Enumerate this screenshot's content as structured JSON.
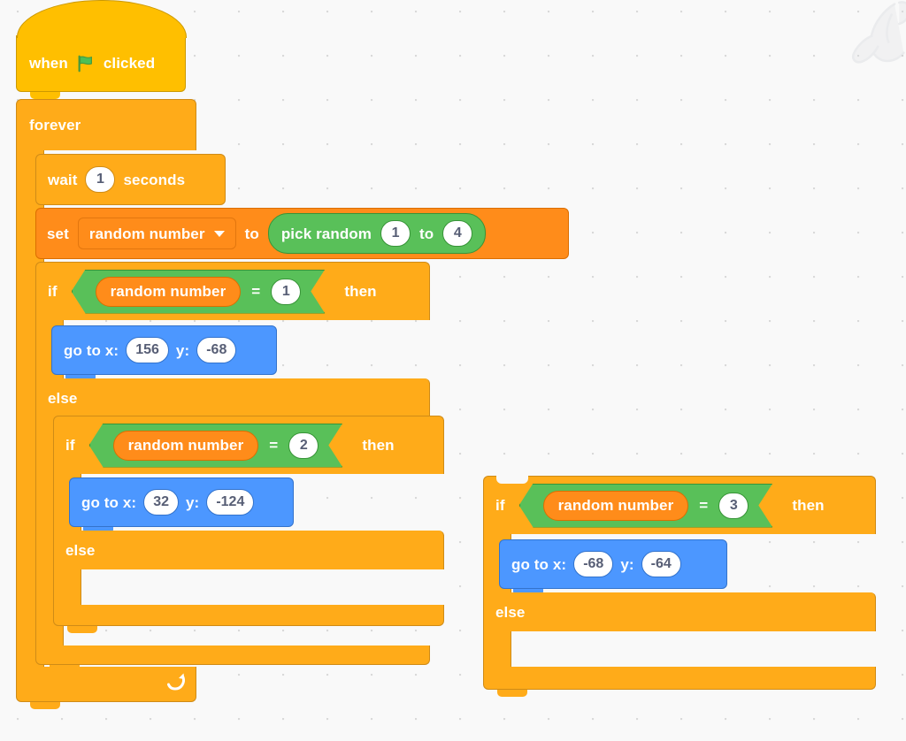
{
  "app": {
    "name": "Scratch",
    "watermark_icon": "scratch-cat-watermark-icon",
    "canvas_background": "#f9f9f9",
    "grid_dot_color": "#d8d8d8"
  },
  "palette": {
    "events": "#ffbf00",
    "control": "#ffab19",
    "variables": "#ff8c1a",
    "motion": "#4c97ff",
    "operators": "#59c059",
    "input_text": "#575e75",
    "block_text": "#ffffff"
  },
  "scripts": [
    {
      "id": "main-script",
      "blocks": {
        "hat": {
          "label_when": "when",
          "flag_icon": "green-flag-icon",
          "label_clicked": "clicked"
        },
        "forever": {
          "label": "forever",
          "loop_arrow_icon": "loop-arrow-icon"
        },
        "wait": {
          "label_wait": "wait",
          "value": "1",
          "label_seconds": "seconds"
        },
        "set_var": {
          "label_set": "set",
          "variable": "random number",
          "dropdown_icon": "chevron-down-icon",
          "label_to": "to",
          "pick_random": {
            "label": "pick random",
            "from": "1",
            "label_to": "to",
            "upto": "4"
          }
        },
        "if_1": {
          "label_if": "if",
          "condition": {
            "left_variable": "random number",
            "operator": "=",
            "right_value": "1"
          },
          "label_then": "then",
          "body": {
            "goto": {
              "label_goto_x": "go to x:",
              "x": "156",
              "label_y": "y:",
              "y": "-68"
            }
          },
          "label_else": "else",
          "if_2": {
            "label_if": "if",
            "condition": {
              "left_variable": "random number",
              "operator": "=",
              "right_value": "2"
            },
            "label_then": "then",
            "body": {
              "goto": {
                "label_goto_x": "go to x:",
                "x": "32",
                "label_y": "y:",
                "y": "-124"
              }
            },
            "label_else": "else",
            "else_body_empty": true
          }
        }
      }
    },
    {
      "id": "detached-script",
      "blocks": {
        "if_3": {
          "label_if": "if",
          "condition": {
            "left_variable": "random number",
            "operator": "=",
            "right_value": "3"
          },
          "label_then": "then",
          "body": {
            "goto": {
              "label_goto_x": "go to x:",
              "x": "-68",
              "label_y": "y:",
              "y": "-64"
            }
          },
          "label_else": "else",
          "else_body_empty": true
        }
      }
    }
  ]
}
